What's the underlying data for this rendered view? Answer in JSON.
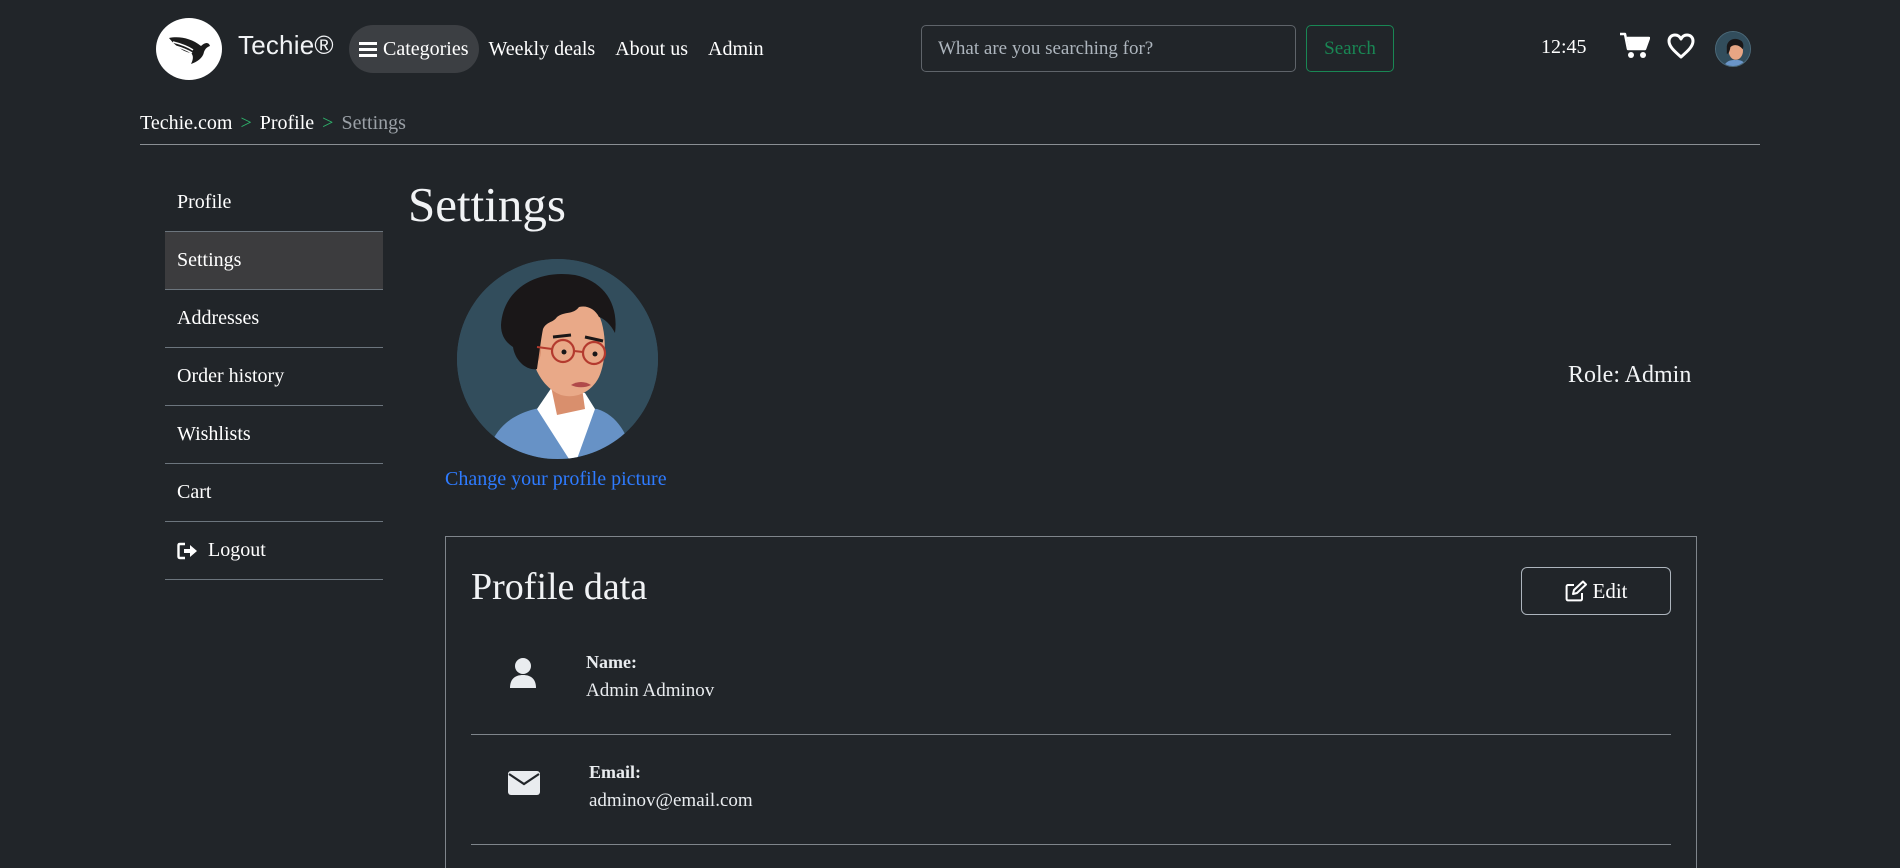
{
  "brand": {
    "name": "Techie®",
    "logo": "bird-logo-icon"
  },
  "nav": {
    "categories": "Categories",
    "links": [
      "Weekly deals",
      "About us",
      "Admin"
    ]
  },
  "search": {
    "placeholder": "What are you searching for?",
    "button": "Search"
  },
  "clock": "12:45",
  "breadcrumb": {
    "home": "Techie.com",
    "sep": ">",
    "profile": "Profile",
    "current": "Settings"
  },
  "sidebar": {
    "items": [
      "Profile",
      "Settings",
      "Addresses",
      "Order history",
      "Wishlists",
      "Cart",
      "Logout"
    ],
    "active": "Settings"
  },
  "page": {
    "title": "Settings",
    "change_picture": "Change your profile picture",
    "role": "Role: Admin"
  },
  "profile_card": {
    "title": "Profile data",
    "edit": "Edit",
    "fields": [
      {
        "label": "Name:",
        "value": "Admin Adminov",
        "icon": "user-icon"
      },
      {
        "label": "Email:",
        "value": "adminov@email.com",
        "icon": "envelope-icon"
      }
    ]
  },
  "colors": {
    "background": "#212529",
    "accent_green": "#198754",
    "link_blue": "#2e7bff"
  }
}
